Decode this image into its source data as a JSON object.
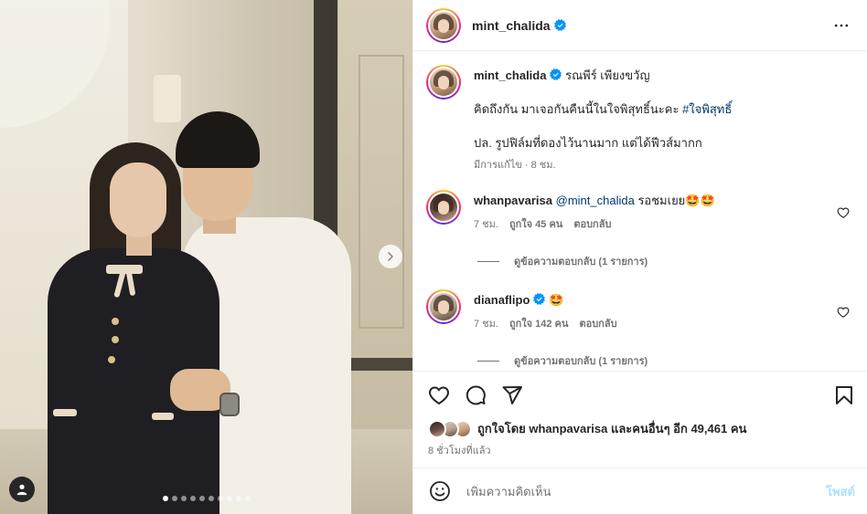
{
  "colors": {
    "text": "#262626",
    "secondary": "#737373",
    "link": "#00376b",
    "verified": "#0095f6",
    "post_disabled": "#b2dffc",
    "divider": "#efefef"
  },
  "header": {
    "username": "mint_chalida",
    "verified": true,
    "more_icon": "more-horizontal-icon"
  },
  "caption": {
    "username": "mint_chalida",
    "verified": true,
    "tagged_name": "รณพีร์ เพียงขวัญ",
    "line1": "คิดถึงกัน มาเจอกันคืนนี้ในใจพิสุทธิ์นะคะ",
    "hashtag": "#ใจพิสุทธิ์",
    "line2": "ปล. รูปฟิล์มที่ดองไว้นานมาก แต่ได้ฟีวส์มากก",
    "meta": "มีการแก้ไข · 8 ชม."
  },
  "comments": [
    {
      "username": "whanpavarisa",
      "verified": false,
      "mention": "@mint_chalida",
      "text": "รอชมเยย",
      "emoji": "🤩🤩",
      "time": "7 ชม.",
      "likes": "ถูกใจ 45 คน",
      "reply": "ตอบกลับ",
      "view_replies": "ดูข้อความตอบกลับ (1 รายการ)"
    },
    {
      "username": "dianaflipo",
      "verified": true,
      "mention": "",
      "text": "",
      "emoji": "🤩",
      "time": "7 ชม.",
      "likes": "ถูกใจ 142 คน",
      "reply": "ตอบกลับ",
      "view_replies": "ดูข้อความตอบกลับ (1 รายการ)"
    }
  ],
  "likes": {
    "text": "ถูกใจโดย whanpavarisa และคนอื่นๆ อีก 49,461 คน",
    "time_ago": "8 ชั่วโมงที่แล้ว"
  },
  "comment_box": {
    "placeholder": "เพิ่มความคิดเห็น",
    "post_label": "โพสต์"
  },
  "carousel": {
    "slide_count": 10,
    "current_slide": 1
  }
}
